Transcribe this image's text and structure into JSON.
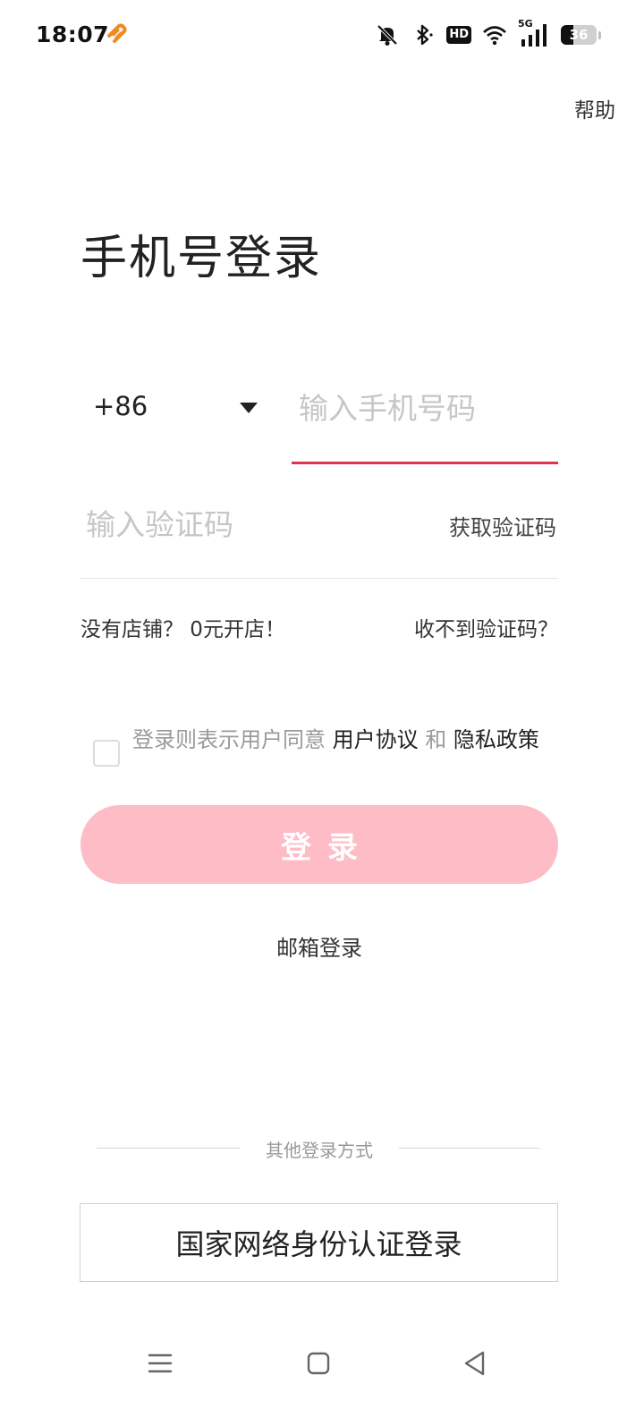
{
  "status_bar": {
    "time": "18:07",
    "hd_label": "HD",
    "network_label": "5G",
    "battery_level": "36",
    "battery_fraction": 0.36
  },
  "header": {
    "help_label": "帮助"
  },
  "login": {
    "title": "手机号登录",
    "country_code": "+86",
    "phone_placeholder": "输入手机号码",
    "code_placeholder": "输入验证码",
    "get_code_label": "获取验证码",
    "open_shop_label": "没有店铺？ 0元开店！",
    "no_code_label": "收不到验证码？",
    "agreement_prefix": "登录则表示用户同意 ",
    "user_agreement_label": "用户协议",
    "agreement_and": " 和 ",
    "privacy_policy_label": "隐私政策",
    "login_button_label": "登录",
    "email_login_label": "邮箱登录"
  },
  "other_login": {
    "divider_label": "其他登录方式",
    "national_id_label": "国家网络身份认证登录"
  },
  "colors": {
    "accent": "#e0344c",
    "login_button_bg": "#fdbcc6",
    "placeholder": "#c6c6c6"
  },
  "icons": {
    "app_notification": "orange-app-icon",
    "mute": "bell-off-icon",
    "bluetooth": "bluetooth-icon",
    "wifi": "wifi-icon",
    "signal": "cellular-signal-icon",
    "battery": "battery-icon",
    "dropdown": "caret-down-icon",
    "nav_menu": "menu-icon",
    "nav_home": "home-square-icon",
    "nav_back": "back-triangle-icon"
  }
}
